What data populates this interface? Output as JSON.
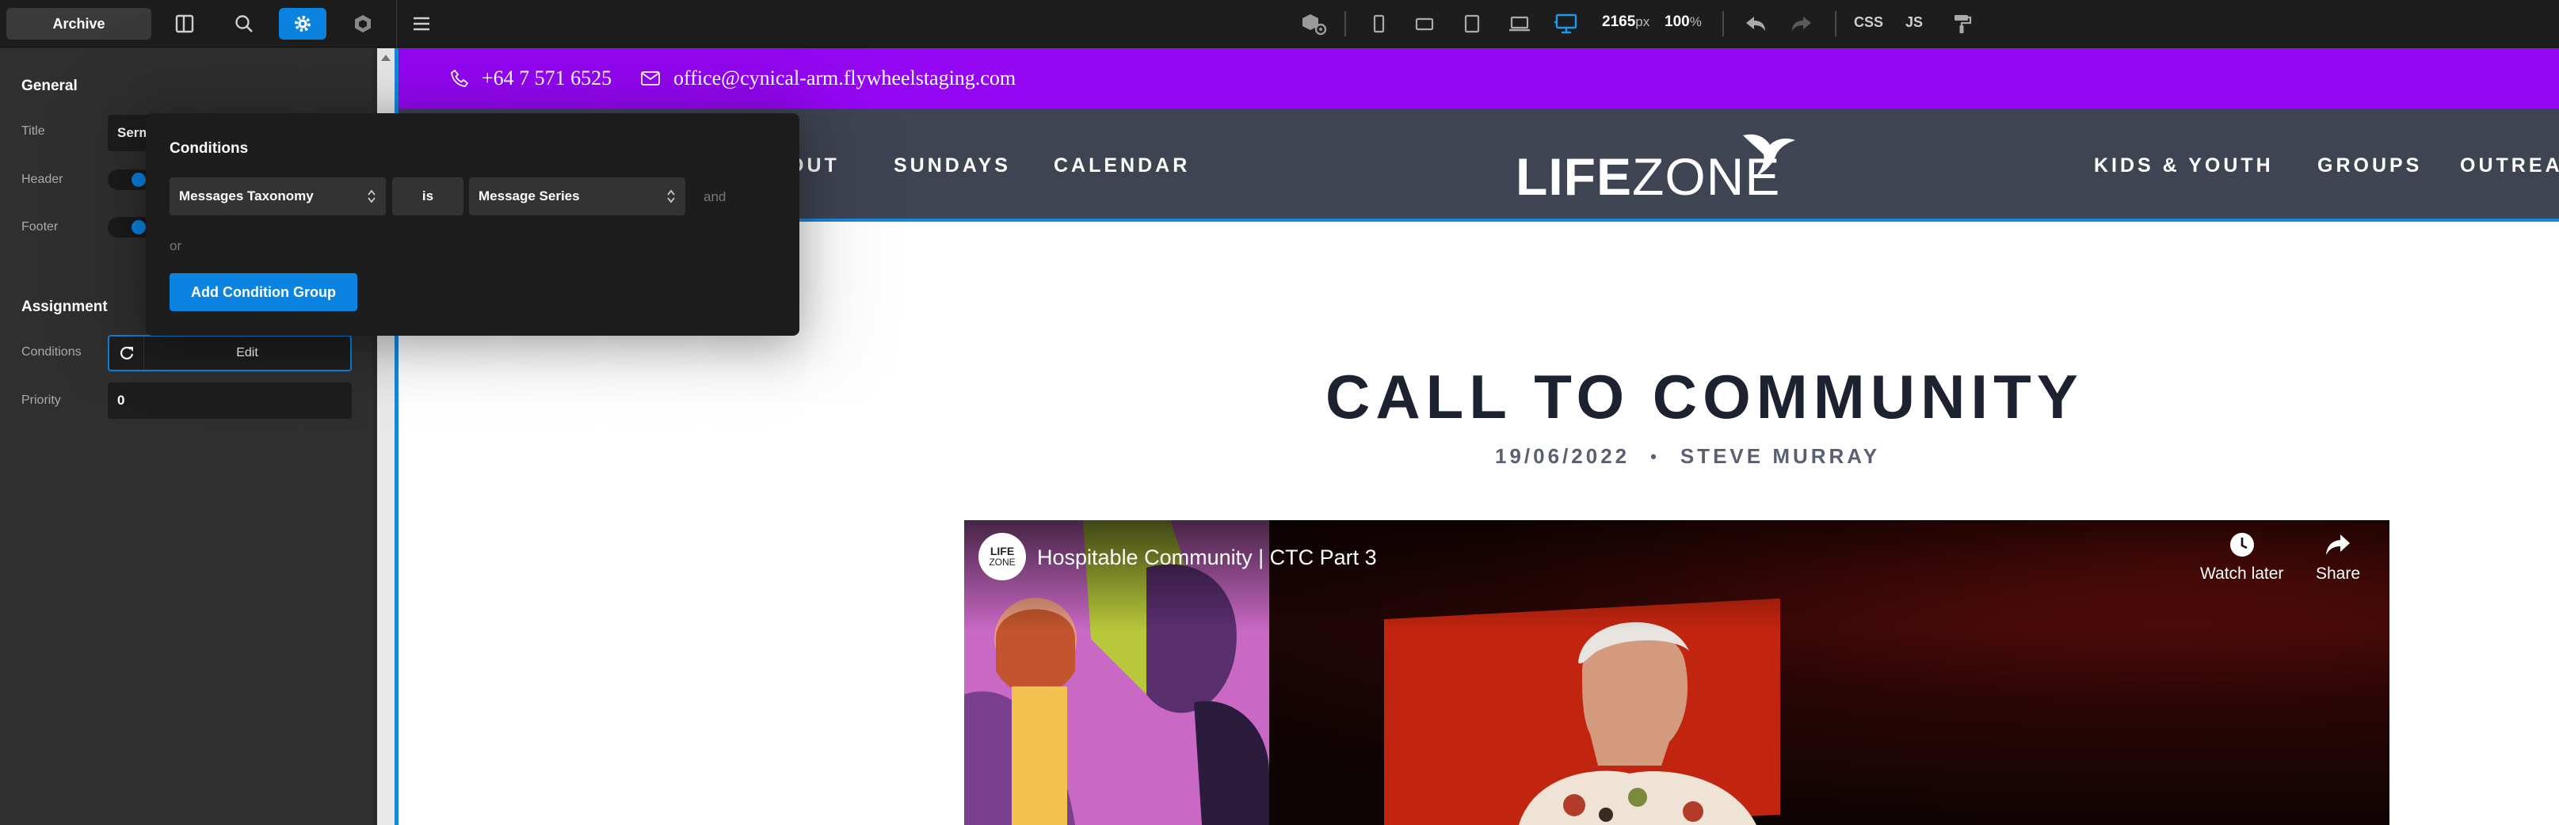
{
  "toolbar": {
    "archive_label": "Archive",
    "canvas_width": "2165",
    "canvas_width_unit": "px",
    "zoom": "100",
    "zoom_unit": "%",
    "css_label": "CSS",
    "js_label": "JS",
    "accent_color": "#0a84e0"
  },
  "left_panel": {
    "general_heading": "General",
    "title_label": "Title",
    "title_value": "Serm",
    "header_label": "Header",
    "footer_label": "Footer",
    "assignment_heading": "Assignment",
    "conditions_label": "Conditions",
    "conditions_edit": "Edit",
    "priority_label": "Priority",
    "priority_value": "0"
  },
  "conditions_popup": {
    "title": "Conditions",
    "field_select": "Messages Taxonomy",
    "operator": "is",
    "value_select": "Message Series",
    "and_label": "and",
    "or_label": "or",
    "add_group_button": "Add Condition Group"
  },
  "site": {
    "topbar_color": "#9407f2",
    "phone": "+64 7 571 6525",
    "email": "office@cynical-arm.flywheelstaging.com",
    "nav_left": [
      "OUT",
      "SUNDAYS",
      "CALENDAR"
    ],
    "nav_right": [
      "KIDS & YOUTH",
      "GROUPS",
      "OUTREA"
    ],
    "logo_bold": "LIFE",
    "logo_thin": "ZONE",
    "post_title": "CALL TO COMMUNITY",
    "post_date": "19/06/2022",
    "post_separator": "•",
    "post_author": "STEVE MURRAY"
  },
  "video": {
    "channel_logo_line1": "LIFE",
    "channel_logo_line2": "ZONE",
    "title": "Hospitable Community | CTC Part 3",
    "watch_later": "Watch later",
    "share": "Share"
  }
}
